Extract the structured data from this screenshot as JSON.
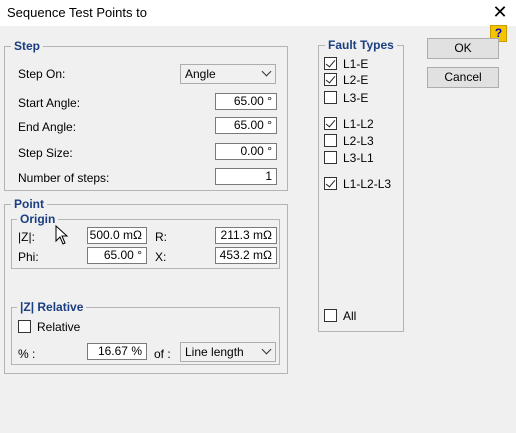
{
  "window": {
    "title": "Sequence Test Points to",
    "close_glyph": "✕",
    "help_glyph": "?"
  },
  "buttons": {
    "ok": "OK",
    "cancel": "Cancel"
  },
  "step": {
    "legend": "Step",
    "step_on_label": "Step On:",
    "step_on_value": "Angle",
    "start_angle_label": "Start Angle:",
    "start_angle_value": "65.00 °",
    "end_angle_label": "End Angle:",
    "end_angle_value": "65.00 °",
    "step_size_label": "Step Size:",
    "step_size_value": "0.00 °",
    "num_steps_label": "Number of steps:",
    "num_steps_value": "1"
  },
  "point": {
    "legend": "Point",
    "origin": {
      "legend": "Origin",
      "z_label": "|Z|:",
      "z_value": "500.0 mΩ",
      "r_label": "R:",
      "r_value": "211.3 mΩ",
      "phi_label": "Phi:",
      "phi_value": "65.00 °",
      "x_label": "X:",
      "x_value": "453.2 mΩ"
    },
    "relative": {
      "legend": "|Z| Relative",
      "relative_label": "Relative",
      "relative_checked": false,
      "percent_label": "% :",
      "percent_value": "16.67 %",
      "of_label": "of :",
      "of_value": "Line length"
    }
  },
  "fault_types": {
    "legend": "Fault Types",
    "items": [
      {
        "label": "L1-E",
        "checked": true
      },
      {
        "label": "L2-E",
        "checked": true
      },
      {
        "label": "L3-E",
        "checked": false
      },
      {
        "label": "L1-L2",
        "checked": true
      },
      {
        "label": "L2-L3",
        "checked": false
      },
      {
        "label": "L3-L1",
        "checked": false
      },
      {
        "label": "L1-L2-L3",
        "checked": true
      }
    ],
    "all_label": "All",
    "all_checked": false
  }
}
